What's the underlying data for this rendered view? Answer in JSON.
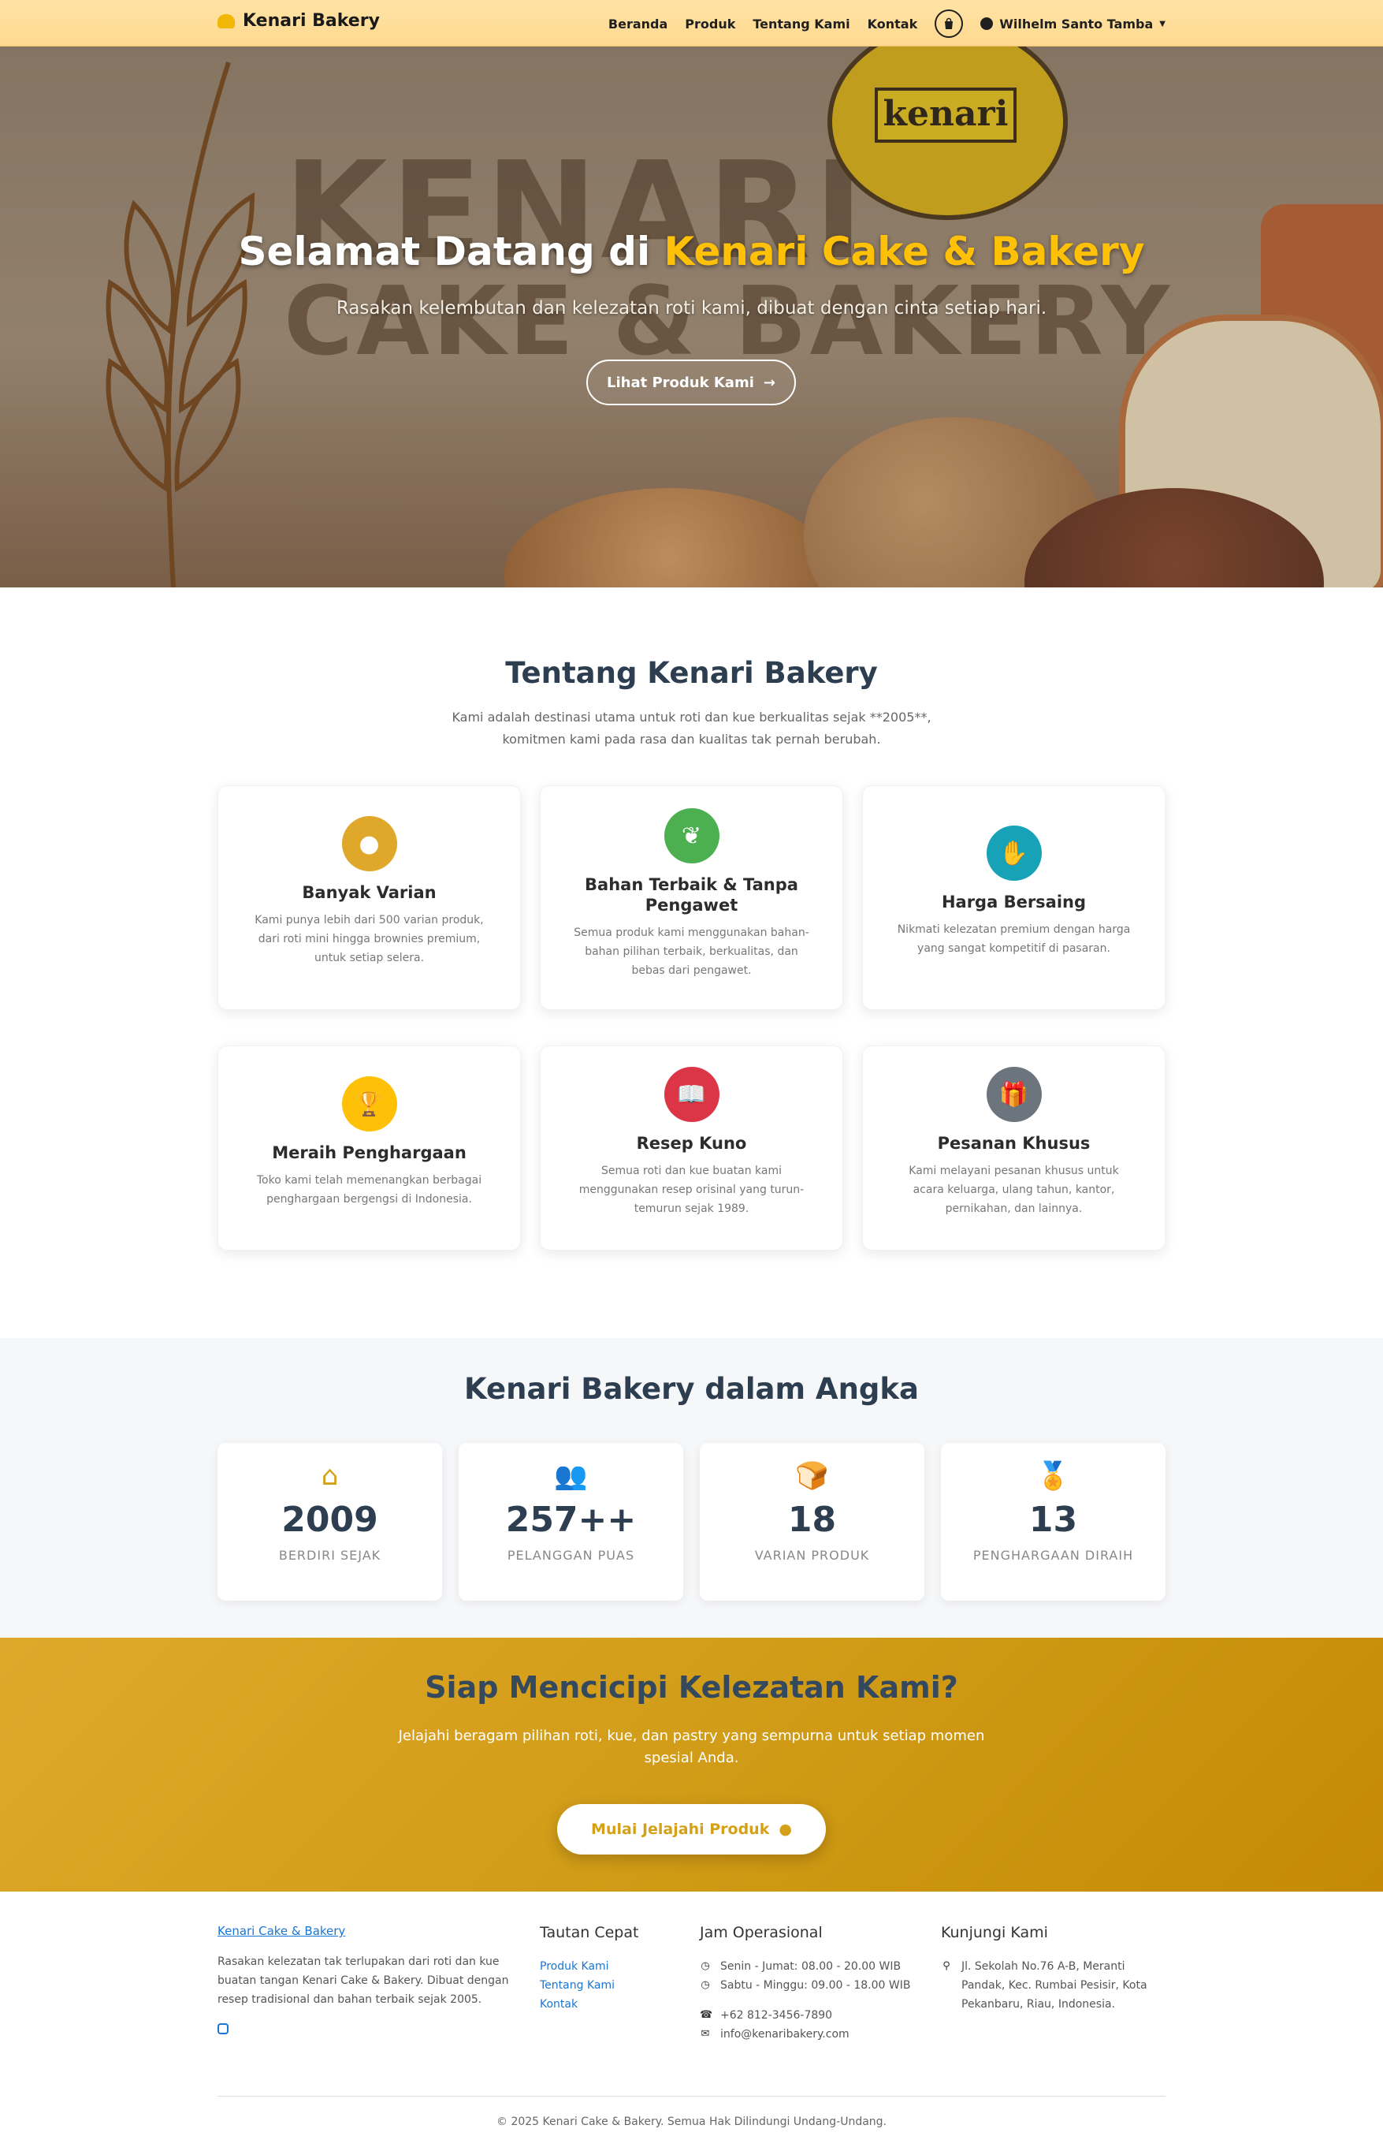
{
  "navbar": {
    "brand": "Kenari Bakery",
    "links": [
      "Beranda",
      "Produk",
      "Tentang Kami",
      "Kontak"
    ],
    "user_name": "Wilhelm Santo Tamba"
  },
  "hero": {
    "bg_word_1": "KENARI",
    "bg_word_2": "CAKE & BAKERY",
    "logo_text": "kenari",
    "title_prefix": "Selamat Datang di ",
    "title_accent": "Kenari Cake & Bakery",
    "subtitle": "Rasakan kelembutan dan kelezatan roti kami, dibuat dengan cinta setiap hari.",
    "button_label": "Lihat Produk Kami"
  },
  "about": {
    "title": "Tentang Kenari Bakery",
    "description": "Kami adalah destinasi utama untuk roti dan kue berkualitas sejak **2005**, komitmen kami pada rasa dan kualitas tak pernah berubah.",
    "cards": [
      {
        "icon": "cookie-icon",
        "color": "#e0a82a",
        "title": "Banyak Varian",
        "text": "Kami punya lebih dari 500 varian produk, dari roti mini hingga brownies premium, untuk setiap selera."
      },
      {
        "icon": "leaf-icon",
        "color": "#4caf50",
        "title": "Bahan Terbaik & Tanpa Pengawet",
        "text": "Semua produk kami menggunakan bahan-bahan pilihan terbaik, berkualitas, dan bebas dari pengawet."
      },
      {
        "icon": "handshake-icon",
        "color": "#17a2b8",
        "title": "Harga Bersaing",
        "text": "Nikmati kelezatan premium dengan harga yang sangat kompetitif di pasaran."
      },
      {
        "icon": "trophy-icon",
        "color": "#ffc107",
        "title": "Meraih Penghargaan",
        "text": "Toko kami telah memenangkan berbagai penghargaan bergengsi di Indonesia."
      },
      {
        "icon": "book-icon",
        "color": "#dc3545",
        "title": "Resep Kuno",
        "text": "Semua roti dan kue buatan kami menggunakan resep orisinal yang turun-temurun sejak 1989."
      },
      {
        "icon": "gift-icon",
        "color": "#6c757d",
        "title": "Pesanan Khusus",
        "text": "Kami melayani pesanan khusus untuk acara keluarga, ulang tahun, kantor, pernikahan, dan lainnya."
      }
    ]
  },
  "stats": {
    "title": "Kenari Bakery dalam Angka",
    "items": [
      {
        "icon": "store-icon",
        "value": "2009",
        "label": "BERDIRI SEJAK"
      },
      {
        "icon": "users-icon",
        "value": "257++",
        "label": "PELANGGAN PUAS"
      },
      {
        "icon": "bread-icon",
        "value": "18",
        "label": "VARIAN PRODUK"
      },
      {
        "icon": "award-icon",
        "value": "13",
        "label": "PENGHARGAAN DIRAIH"
      }
    ]
  },
  "cta": {
    "title": "Siap Mencicipi Kelezatan Kami?",
    "description": "Jelajahi beragam pilihan roti, kue, dan pastry yang sempurna untuk setiap momen spesial Anda.",
    "button_label": "Mulai Jelajahi Produk"
  },
  "footer": {
    "brand": "Kenari Cake & Bakery",
    "about": "Rasakan kelezatan tak terlupakan dari roti dan kue buatan tangan Kenari Cake & Bakery. Dibuat dengan resep tradisional dan bahan terbaik sejak 2005.",
    "quick_links_title": "Tautan Cepat",
    "quick_links": [
      "Produk Kami",
      "Tentang Kami",
      "Kontak"
    ],
    "hours_title": "Jam Operasional",
    "hours_weekday": "Senin - Jumat: 08.00 - 20.00 WIB",
    "hours_weekend": "Sabtu - Minggu: 09.00 - 18.00 WIB",
    "phone": "+62 812-3456-7890",
    "email": "info@kenaribakery.com",
    "visit_title": "Kunjungi Kami",
    "address": "Jl. Sekolah No.76 A-B, Meranti Pandak, Kec. Rumbai Pesisir, Kota Pekanbaru, Riau, Indonesia.",
    "copyright": "© 2025 Kenari Cake & Bakery. Semua Hak Dilindungi Undang-Undang."
  }
}
